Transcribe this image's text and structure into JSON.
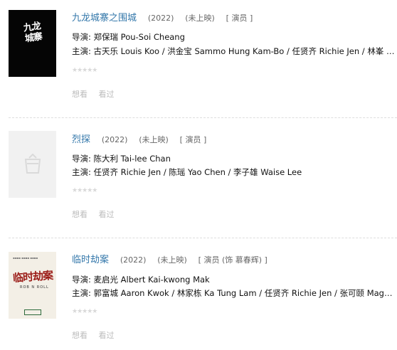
{
  "items": [
    {
      "title": "九龙城寨之围城",
      "year": "(2022)",
      "status": "(未上映)",
      "role": "[ 演员 ]",
      "director_label": "导演:",
      "director": "郑保瑞 Pou-Soi Cheang",
      "cast_label": "主演:",
      "cast": "古天乐 Louis Koo / 洪金宝 Sammo Hung Kam-Bo / 任贤齐 Richie Jen / 林峯 R...",
      "stars": "★★★★★",
      "want_label": "想看",
      "seen_label": "看过",
      "poster_text": "九龙城寨"
    },
    {
      "title": "烈探",
      "year": "(2022)",
      "status": "(未上映)",
      "role": "[ 演员 ]",
      "director_label": "导演:",
      "director": "陈大利 Tai-lee Chan",
      "cast_label": "主演:",
      "cast": "任贤齐 Richie Jen / 陈瑶 Yao Chen / 李子雄 Waise Lee",
      "stars": "★★★★★",
      "want_label": "想看",
      "seen_label": "看过"
    },
    {
      "title": "临时劫案",
      "year": "(2022)",
      "status": "(未上映)",
      "role": "[ 演员 (饰 慕春辉) ]",
      "director_label": "导演:",
      "director": "麦启光 Albert Kai-kwong Mak",
      "cast_label": "主演:",
      "cast": "郭富城 Aaron Kwok / 林家栋 Ka Tung Lam / 任贤齐 Richie Jen / 张可颐 Magg...",
      "stars": "★★★★★",
      "want_label": "想看",
      "seen_label": "看过",
      "poster_text": "临时劫案",
      "poster_subtitle": "ROB N ROLL"
    }
  ]
}
